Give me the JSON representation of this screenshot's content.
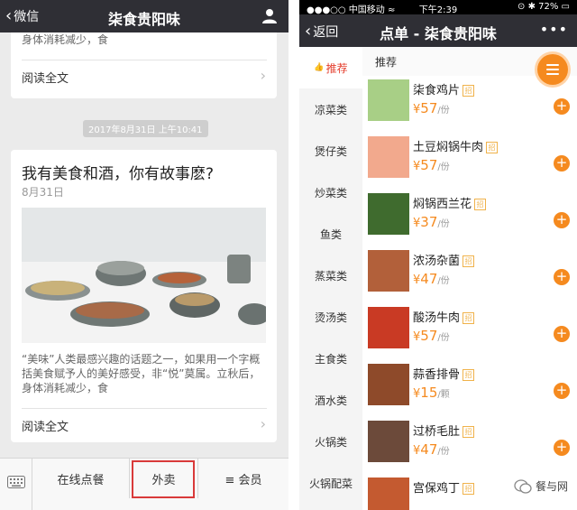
{
  "left": {
    "header": {
      "back_label": "微信",
      "title": "柒食贵阳味"
    },
    "card1": {
      "snippet_line1": "身体消耗减少，食",
      "read_all": "阅读全文"
    },
    "timestamp": "2017年8月31日 上午10:41",
    "card2": {
      "title": "我有美食和酒，你有故事麽?",
      "date": "8月31日",
      "desc": "“美味”人类最感兴趣的话题之一，如果用一个字概括美食赋予人的美好感受，非“悦”莫属。立秋后，身体消耗减少，食",
      "read_all": "阅读全文"
    },
    "bottom_tabs": [
      {
        "label": "在线点餐"
      },
      {
        "label": "外卖"
      },
      {
        "label": "≡ 会员"
      }
    ]
  },
  "right": {
    "status": {
      "carrier": "●●●○○ 中国移动 ≈",
      "time": "下午2:39",
      "battery": "⊙ ✱ 72% ▭"
    },
    "header": {
      "back_label": "返回",
      "title": "点单 -  柒食贵阳味",
      "more": "•••"
    },
    "section_title": "推荐",
    "categories": [
      {
        "label": "推荐",
        "active": true
      },
      {
        "label": "凉菜类"
      },
      {
        "label": "煲仔类"
      },
      {
        "label": "炒菜类"
      },
      {
        "label": "鱼类"
      },
      {
        "label": "蒸菜类"
      },
      {
        "label": "烫汤类"
      },
      {
        "label": "主食类"
      },
      {
        "label": "酒水类"
      },
      {
        "label": "火锅类"
      },
      {
        "label": "火锅配菜"
      }
    ],
    "tag_label": "招",
    "items": [
      {
        "name": "柒食鸡片",
        "price": "57",
        "unit": "/份",
        "color": "#a8cf86"
      },
      {
        "name": "土豆焖锅牛肉",
        "price": "57",
        "unit": "/份",
        "color": "#f2a98d"
      },
      {
        "name": "焖锅西兰花",
        "price": "37",
        "unit": "/份",
        "color": "#3f6b2e"
      },
      {
        "name": "浓汤杂菌",
        "price": "47",
        "unit": "/份",
        "color": "#b2603a"
      },
      {
        "name": "酸汤牛肉",
        "price": "57",
        "unit": "/份",
        "color": "#c93a24"
      },
      {
        "name": "蒜香排骨",
        "price": "15",
        "unit": "/颗",
        "color": "#8e4a2a"
      },
      {
        "name": "过桥毛肚",
        "price": "47",
        "unit": "/份",
        "color": "#6c4a3a"
      },
      {
        "name": "宫保鸡丁",
        "price": "",
        "unit": "",
        "color": "#c45a30"
      }
    ],
    "currency": "¥",
    "add_symbol": "+",
    "watermark": "餐与网"
  }
}
